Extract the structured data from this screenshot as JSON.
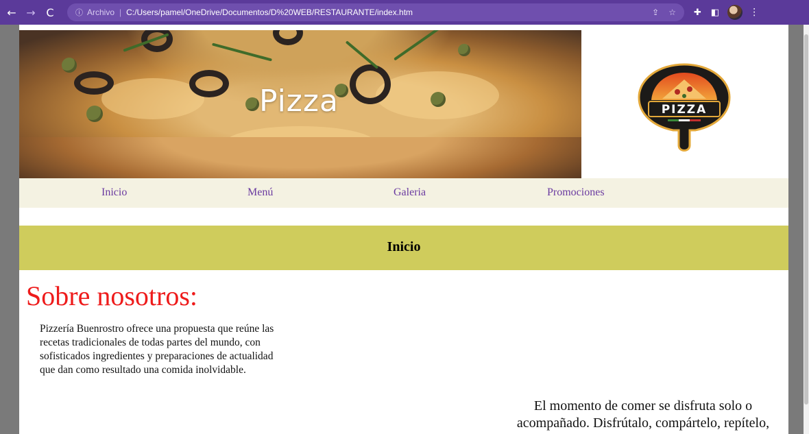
{
  "browser": {
    "address_info_label": "Archivo",
    "address_url": "C:/Users/pamel/OneDrive/Documentos/D%20WEB/RESTAURANTE/index.htm"
  },
  "banner": {
    "title": "Pizza"
  },
  "logo": {
    "text": "PIZZA"
  },
  "nav": {
    "items": [
      {
        "label": "Inicio"
      },
      {
        "label": "Menú"
      },
      {
        "label": "Galeria"
      },
      {
        "label": "Promociones"
      }
    ]
  },
  "section": {
    "title": "Inicio"
  },
  "about": {
    "heading": "Sobre nosotros:",
    "body": "Pizzería Buenrostro ofrece una propuesta que reúne las recetas tradicionales de todas partes del mundo, con sofisticados ingredientes y preparaciones de actualidad que dan como resultado una comida inolvidable."
  },
  "quote": {
    "text": "El momento de comer se disfruta solo o acompañado. Disfrútalo, compártelo, repítelo,"
  },
  "colors": {
    "browser_frame": "#5b3a9a",
    "nav_link": "#6a3aa0",
    "nav_bar": "#f4f2e2",
    "section_band": "#cfcc5c",
    "heading_red": "#ee1b1b"
  }
}
